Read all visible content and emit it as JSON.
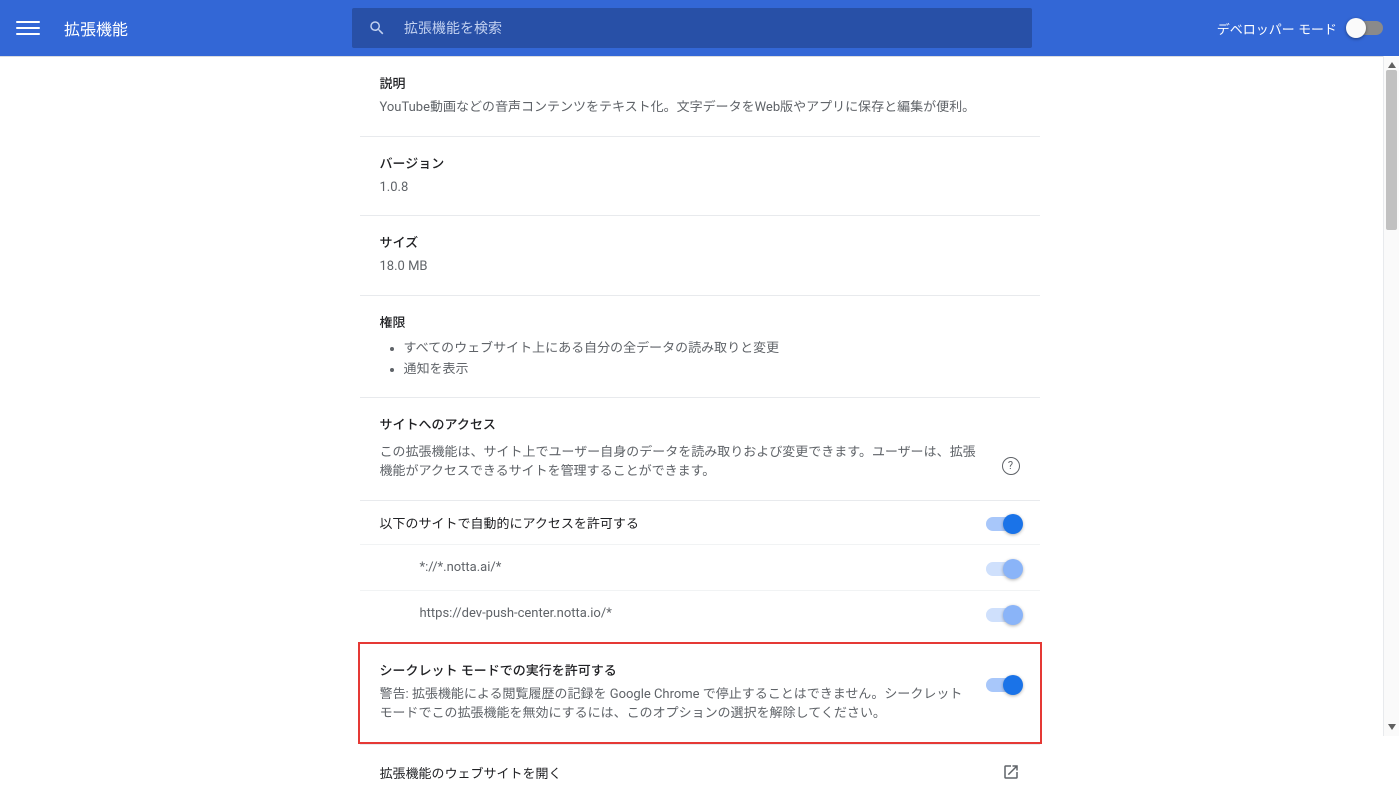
{
  "header": {
    "title": "拡張機能",
    "search_placeholder": "拡張機能を検索",
    "dev_mode_label": "デベロッパー モード"
  },
  "sections": {
    "description": {
      "label": "説明",
      "body": "YouTube動画などの音声コンテンツをテキスト化。文字データをWeb版やアプリに保存と編集が便利。"
    },
    "version": {
      "label": "バージョン",
      "body": "1.0.8"
    },
    "size": {
      "label": "サイズ",
      "body": "18.0 MB"
    },
    "permissions": {
      "label": "権限",
      "items": [
        "すべてのウェブサイト上にある自分の全データの読み取りと変更",
        "通知を表示"
      ]
    },
    "site_access": {
      "label": "サイトへのアクセス",
      "body": "この拡張機能は、サイト上でユーザー自身のデータを読み取りおよび変更できます。ユーザーは、拡張機能がアクセスできるサイトを管理することができます。"
    },
    "auto_allow": {
      "label": "以下のサイトで自動的にアクセスを許可する",
      "sites": [
        "*://*.notta.ai/*",
        "https://dev-push-center.notta.io/*"
      ]
    },
    "incognito": {
      "label": "シークレット モードでの実行を許可する",
      "body": "警告: 拡張機能による閲覧履歴の記録を Google Chrome で停止することはできません。シークレット モードでこの拡張機能を無効にするには、このオプションの選択を解除してください。"
    },
    "open_site": {
      "label": "拡張機能のウェブサイトを開く"
    }
  }
}
